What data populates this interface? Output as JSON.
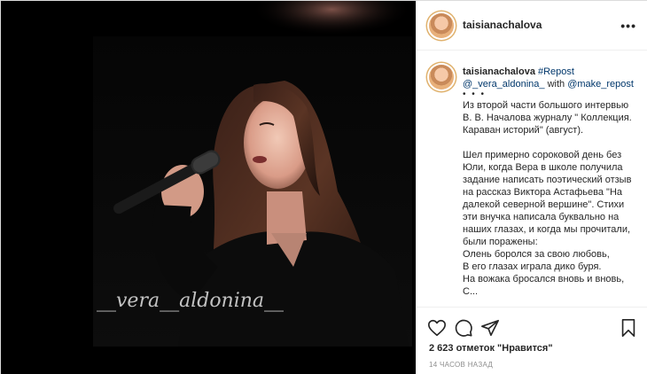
{
  "post": {
    "username": "taisianachalova",
    "watermark": "__vera__aldonina__"
  },
  "caption": {
    "username": "taisianachalova",
    "hashtag": "#Repost",
    "source_mention": "@_vera_aldonina_",
    "with_word": "with",
    "repost_mention": "@make_repost",
    "dots": "• • •",
    "paragraph_1": "Из второй части большого интервью В. В. Началова журналу \" Коллекция. Караван историй\" (август).",
    "paragraph_2_lines": [
      "Шел примерно сороковой день без Юли, когда Вера в школе получила задание написать поэтический отзыв на рассказ Виктора Астафьева \"На далекой северной вершине\". Стихи эти внучка написала буквально на наших глазах, и когда мы прочитали, были поражены:",
      "Олень боролся за свою любовь,",
      "В его глазах играла дико буря.",
      "На вожака бросался вновь и вновь,",
      "С..."
    ]
  },
  "actions": {
    "likes": "2 623 отметок \"Нравится\"",
    "time": "14 ЧАСОВ НАЗАД"
  },
  "icons": {
    "like": "heart-icon",
    "comment": "comment-icon",
    "share": "paper-plane-icon",
    "save": "bookmark-icon",
    "more": "more-options-icon"
  }
}
